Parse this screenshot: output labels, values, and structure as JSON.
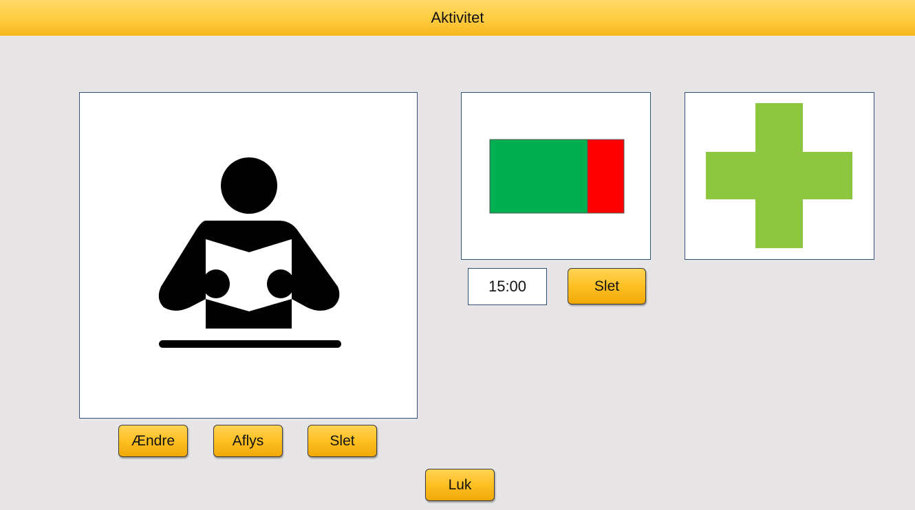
{
  "window": {
    "title": "Aktivitet"
  },
  "activity": {
    "icon": "person-reading-icon",
    "buttons": {
      "change_label": "Ændre",
      "cancel_label": "Aflys",
      "delete_label": "Slet"
    }
  },
  "time_slot": {
    "icon": "progress-bar-icon",
    "progress_fraction": 0.73,
    "colors": {
      "elapsed": "#00b050",
      "remaining": "#ff0000"
    },
    "time_value": "15:00",
    "delete_label": "Slet"
  },
  "add": {
    "icon": "plus-icon",
    "color": "#8dc63f"
  },
  "footer": {
    "close_label": "Luk"
  }
}
